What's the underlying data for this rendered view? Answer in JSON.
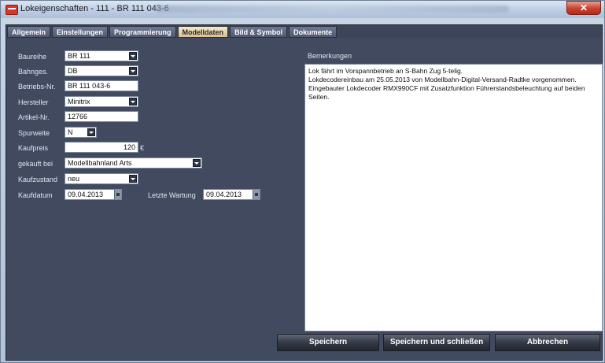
{
  "window": {
    "title": "Lokeigenschaften - 111 - BR 111 043-6",
    "close_glyph": "✕"
  },
  "tabs": [
    {
      "label": "Allgemein"
    },
    {
      "label": "Einstellungen"
    },
    {
      "label": "Programmierung"
    },
    {
      "label": "Modelldaten",
      "active": true
    },
    {
      "label": "Bild & Symbol"
    },
    {
      "label": "Dokumente"
    }
  ],
  "form": {
    "baureihe": {
      "label": "Baureihe",
      "value": "BR 111"
    },
    "bahnges": {
      "label": "Bahnges.",
      "value": "DB"
    },
    "betriebs_nr": {
      "label": "Betriebs-Nr.",
      "value": "BR 111 043-6"
    },
    "hersteller": {
      "label": "Hersteller",
      "value": "Minitrix"
    },
    "artikel_nr": {
      "label": "Artikel-Nr.",
      "value": "12766"
    },
    "spurweite": {
      "label": "Spurweite",
      "value": "N"
    },
    "kaufpreis": {
      "label": "Kaufpreis",
      "value": "120",
      "unit": "€"
    },
    "gekauft_bei": {
      "label": "gekauft bei",
      "value": "Modellbahnland Arts"
    },
    "kaufzustand": {
      "label": "Kaufzustand",
      "value": "neu"
    },
    "kaufdatum": {
      "label": "Kaufdatum",
      "value": "09.04.2013"
    },
    "letzte_wartung": {
      "label": "Letzte Wartung",
      "value": "09.04.2013"
    }
  },
  "remarks": {
    "label": "Bemerkungen",
    "lines": [
      "Lok fährt im Vorspannbetrieb an S-Bahn Zug 5-telig.",
      "Lokdecodereinbau am 25.05.2013 von Modellbahn-Digital-Versand-Radtke vorgenommen.",
      "Eingebauter Lokdecoder RMX990CF mit Zusatzfunktion Führerstandsbeleuchtung auf beiden Seiten."
    ]
  },
  "buttons": {
    "save": "Speichern",
    "save_close": "Speichern und schließen",
    "cancel": "Abbrechen"
  },
  "colors": {
    "panel_background": "#414a5f",
    "active_tab": "#e9d6ad",
    "close_button": "#c7402e"
  },
  "icons": [
    "app-icon",
    "close-icon",
    "chevron-down-icon",
    "calendar-icon"
  ]
}
